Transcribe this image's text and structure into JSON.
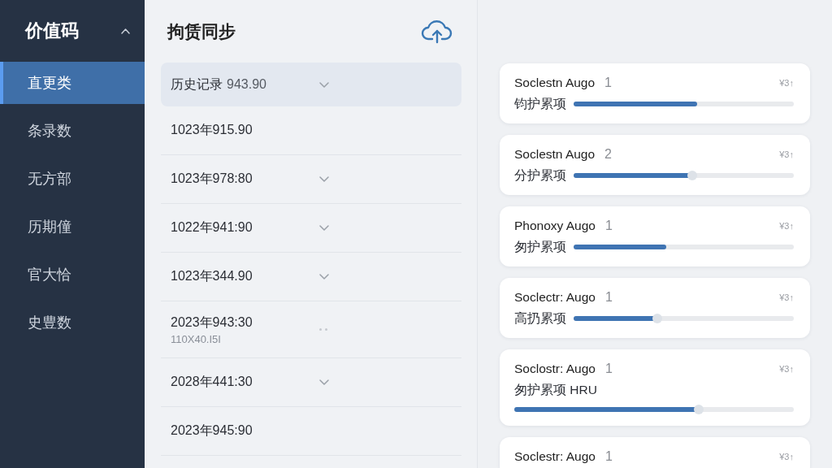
{
  "sidebar": {
    "header": {
      "title": "价值码",
      "expanded": true
    },
    "items": [
      {
        "label": "直更类",
        "selected": true
      },
      {
        "label": "条录数",
        "selected": false
      },
      {
        "label": "无方部",
        "selected": false
      },
      {
        "label": "历期僮",
        "selected": false
      },
      {
        "label": "官大恰",
        "selected": false
      },
      {
        "label": "史豊数",
        "selected": false
      }
    ]
  },
  "sync_panel": {
    "title": "拘赁同步",
    "rows": [
      {
        "label": "历史记录",
        "value": "943.90",
        "kind": "chevron",
        "selected": true
      },
      {
        "label": "1023年915.90",
        "kind": "plain",
        "selected": false
      },
      {
        "label": "1023年978:80",
        "kind": "chevron",
        "selected": false
      },
      {
        "label": "1022年941:90",
        "kind": "chevron",
        "selected": false
      },
      {
        "label": "1023年344.90",
        "kind": "chevron",
        "selected": false
      },
      {
        "label": "2023年943:30",
        "sublabel": "110X40.I5I",
        "kind": "dots",
        "selected": false
      },
      {
        "label": "2028年441:30",
        "kind": "chevron",
        "selected": false
      },
      {
        "label": "2023年945:90",
        "kind": "plain",
        "selected": false
      }
    ]
  },
  "cards": [
    {
      "title": "Soclestn Augo",
      "count": "1",
      "price": "¥3↑",
      "label": "钧护累项",
      "kind": "progress",
      "level": 0.56
    },
    {
      "title": "Soclestn Augo",
      "count": "2",
      "price": "¥3↑",
      "label": "分护累项",
      "kind": "slider",
      "level": 0.54
    },
    {
      "title": "Phonoxy Augo",
      "count": "1",
      "price": "¥3↑",
      "label": "匆护累项",
      "kind": "progress",
      "level": 0.42
    },
    {
      "title": "Soclectr: Augo",
      "count": "1",
      "price": "¥3↑",
      "label": "高扔累项",
      "kind": "slider",
      "level": 0.38
    },
    {
      "title": "Soclostr: Augo",
      "count": "1",
      "price": "¥3↑",
      "label": "匆护累项 HRU",
      "kind": "stacked",
      "level": 0.66
    },
    {
      "title": "Soclestr: Augo",
      "count": "1",
      "price": "¥3↑"
    }
  ]
}
